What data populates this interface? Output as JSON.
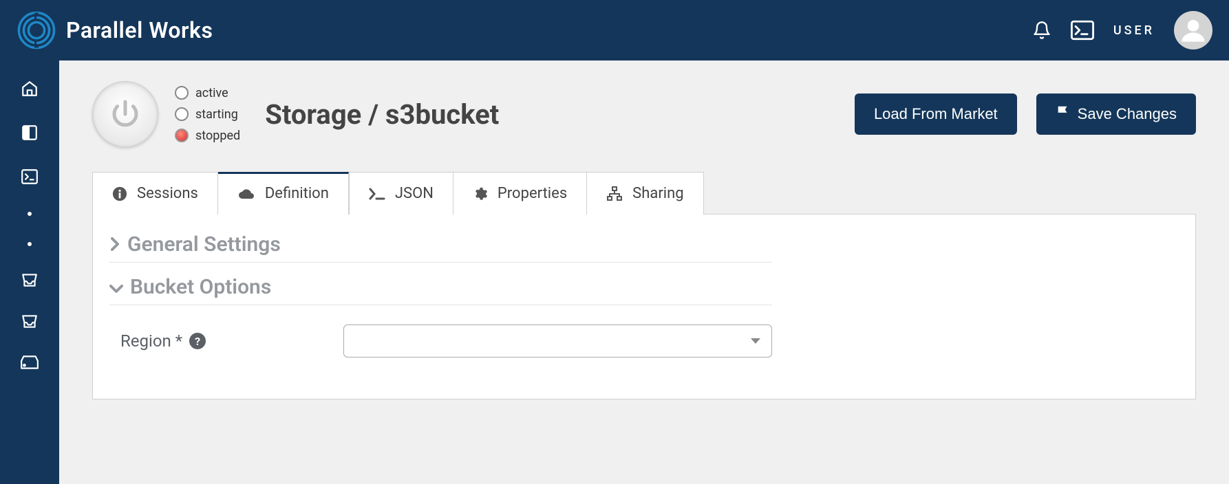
{
  "brand": {
    "name": "Parallel Works"
  },
  "topbar": {
    "user_label": "USER"
  },
  "sidebar": {
    "items": [
      {
        "name": "home-icon"
      },
      {
        "name": "workspace-icon"
      },
      {
        "name": "terminal-icon"
      },
      {
        "name": "dot-1"
      },
      {
        "name": "dot-2"
      },
      {
        "name": "inbox-1-icon"
      },
      {
        "name": "inbox-2-icon"
      },
      {
        "name": "storage-icon"
      }
    ]
  },
  "status": {
    "active_label": "active",
    "starting_label": "starting",
    "stopped_label": "stopped"
  },
  "page": {
    "title": "Storage / s3bucket"
  },
  "actions": {
    "load_label": "Load From Market",
    "save_label": "Save Changes"
  },
  "tabs": [
    {
      "label": "Sessions"
    },
    {
      "label": "Definition"
    },
    {
      "label": "JSON"
    },
    {
      "label": "Properties"
    },
    {
      "label": "Sharing"
    }
  ],
  "active_tab_index": 1,
  "sections": {
    "general": {
      "title": "General Settings",
      "expanded": false
    },
    "bucket": {
      "title": "Bucket Options",
      "expanded": true
    }
  },
  "form": {
    "region": {
      "label": "Region *",
      "value": "",
      "help": "?"
    }
  }
}
